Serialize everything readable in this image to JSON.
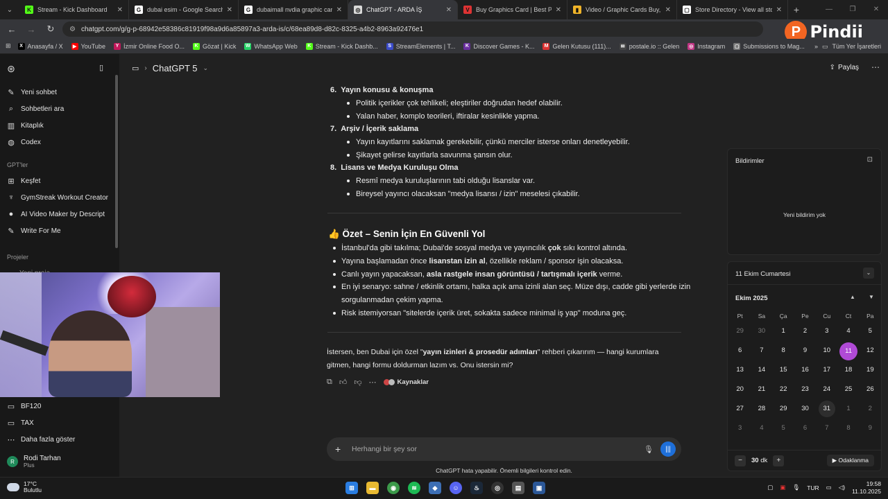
{
  "tabs": [
    {
      "label": "Stream - Kick Dashboard",
      "fav": "K",
      "color": "#53fc18",
      "active": false
    },
    {
      "label": "dubai esim - Google Search",
      "fav": "G",
      "color": "#ffffff",
      "active": false
    },
    {
      "label": "dubaimall nvdia graphic card -",
      "fav": "G",
      "color": "#ffffff",
      "active": false
    },
    {
      "label": "ChatGPT - ARDA İŞ",
      "fav": "◎",
      "color": "#d9d9d9",
      "active": true
    },
    {
      "label": "Buy Graphics Card | Best Price",
      "fav": "V",
      "color": "#d33",
      "active": false
    },
    {
      "label": "Video / Graphic Cards Buy, Bes",
      "fav": "▮",
      "color": "#f0b429",
      "active": false
    },
    {
      "label": "Store Directory - View all store",
      "fav": "▢",
      "color": "#ffffff",
      "active": false
    }
  ],
  "url": "chatgpt.com/g/g-p-68942e58386c81919f98a9d6a85897a3-arda-is/c/68ea89d8-d82c-8325-a4b2-8963a92476e1",
  "overlay_logo": {
    "letter": "P",
    "name": "Pindii"
  },
  "bookmarks": [
    {
      "label": "Anasayfa / X",
      "icon": "X",
      "color": "#000000"
    },
    {
      "label": "YouTube",
      "icon": "▶",
      "color": "#ff0000"
    },
    {
      "label": "İzmir Online Food O...",
      "icon": "Y",
      "color": "#c2185b"
    },
    {
      "label": "Gözat | Kick",
      "icon": "K",
      "color": "#53fc18"
    },
    {
      "label": "WhatsApp Web",
      "icon": "W",
      "color": "#25d366"
    },
    {
      "label": "Stream - Kick Dashb...",
      "icon": "K",
      "color": "#53fc18"
    },
    {
      "label": "StreamElements | T...",
      "icon": "S",
      "color": "#3b4cca"
    },
    {
      "label": "Discover Games - K...",
      "icon": "K",
      "color": "#6b2fa0"
    },
    {
      "label": "Gelen Kutusu (111)...",
      "icon": "M",
      "color": "#d33"
    },
    {
      "label": "postale.io :: Gelen",
      "icon": "✉",
      "color": "#444"
    },
    {
      "label": "Instagram",
      "icon": "◎",
      "color": "#c13584"
    },
    {
      "label": "Submissions to Mag...",
      "icon": "▢",
      "color": "#777"
    }
  ],
  "bookmarks_more": "»",
  "bookmarks_all": "Tüm Yer İşaretleri",
  "sidebar": {
    "items": [
      {
        "label": "Yeni sohbet",
        "icon": "✎"
      },
      {
        "label": "Sohbetleri ara",
        "icon": "⌕"
      },
      {
        "label": "Kitaplık",
        "icon": "▥"
      },
      {
        "label": "Codex",
        "icon": "◍"
      }
    ],
    "gpts_heading": "GPT'ler",
    "gpts": [
      {
        "label": "Keşfet",
        "icon": "⊞"
      },
      {
        "label": "GymStreak Workout Creator",
        "icon": "♆"
      },
      {
        "label": "AI Video Maker by Descript",
        "icon": "●"
      },
      {
        "label": "Write For Me",
        "icon": "✎"
      }
    ],
    "projects_heading": "Projeler",
    "projects_partial": "Yeni proje",
    "folders": [
      {
        "label": "BF120",
        "icon": "▭"
      },
      {
        "label": "TAX",
        "icon": "▭"
      }
    ],
    "show_more": "Daha fazla göster",
    "user": {
      "initial": "R",
      "name": "Rodi Tarhan",
      "plan": "Plus"
    }
  },
  "header": {
    "model": "ChatGPT 5",
    "share": "Paylaş"
  },
  "content": {
    "sections": [
      {
        "num": "6.",
        "title": "Yayın konusu & konuşma",
        "bullets": [
          "Politik içerikler çok tehlikeli; eleştiriler doğrudan hedef olabilir.",
          "Yalan haber, komplo teorileri, iftiralar kesinlikle yapma."
        ]
      },
      {
        "num": "7.",
        "title": "Arşiv / İçerik saklama",
        "bullets": [
          "Yayın kayıtlarını saklamak gerekebilir, çünkü merciler isterse onları denetleyebilir.",
          "Şikayet gelirse kayıtlarla savunma şansın olur."
        ]
      },
      {
        "num": "8.",
        "title": "Lisans ve Medya Kuruluşu Olma",
        "bullets": [
          "Resmî medya kuruluşlarının tabi olduğu lisanslar var.",
          "Bireysel yayıncı olacaksan \"medya lisansı / izin\" meselesi çıkabilir."
        ]
      }
    ],
    "summary_title": "👍 Özet – Senin İçin En Güvenli Yol",
    "summary": [
      {
        "pre": "İstanbul'da gibi takılma; Dubai'de sosyal medya ve yayıncılık ",
        "bold": "çok",
        "post": " sıkı kontrol altında."
      },
      {
        "pre": "Yayına başlamadan önce ",
        "bold": "lisanstan izin al",
        "post": ", özellikle reklam / sponsor işin olacaksa."
      },
      {
        "pre": "Canlı yayın yapacaksan, ",
        "bold": "asla rastgele insan görüntüsü / tartışmalı içerik",
        "post": " verme."
      },
      {
        "pre": "En iyi senaryo: sahne / etkinlik ortamı, halka açık ama izinli alan seç. Müze dışı, cadde gibi yerlerde izin",
        "bold": "",
        "post": ""
      },
      {
        "pre": "sorgulanmadan çekim yapma.",
        "bold": "",
        "post": ""
      },
      {
        "pre": "Risk istemiyorsan \"sitelerde içerik üret, sokakta sadece minimal iş yap\" moduna geç.",
        "bold": "",
        "post": ""
      }
    ],
    "closing_pre": "İstersen, ben Dubai için özel \"",
    "closing_bold": "yayın izinleri & prosedür adımları",
    "closing_post": "\" rehberi çıkarırım — hangi kurumlara",
    "closing_line2": "gitmen, hangi formu doldurman lazım vs. Onu istersin mi?",
    "sources_label": "Kaynaklar"
  },
  "composer": {
    "placeholder": "Herhangi bir şey sor",
    "disclaimer": "ChatGPT hata yapabilir. Önemli bilgileri kontrol edin."
  },
  "notifications": {
    "title": "Bildirimler",
    "empty": "Yeni bildirim yok"
  },
  "calendar": {
    "date_header": "11 Ekim Cumartesi",
    "month": "Ekim 2025",
    "weekdays": [
      "Pt",
      "Sa",
      "Ça",
      "Pe",
      "Cu",
      "Ct",
      "Pa"
    ],
    "weeks": [
      [
        "29",
        "30",
        "1",
        "2",
        "3",
        "4",
        "5"
      ],
      [
        "6",
        "7",
        "8",
        "9",
        "10",
        "11",
        "12"
      ],
      [
        "13",
        "14",
        "15",
        "16",
        "17",
        "18",
        "19"
      ],
      [
        "20",
        "21",
        "22",
        "23",
        "24",
        "25",
        "26"
      ],
      [
        "27",
        "28",
        "29",
        "30",
        "31",
        "1",
        "2"
      ],
      [
        "3",
        "4",
        "5",
        "6",
        "7",
        "8",
        "9"
      ]
    ],
    "today": "11",
    "focus_minutes": "30",
    "focus_unit": "dk",
    "focus_label": "Odaklanma"
  },
  "taskbar": {
    "temp": "17°C",
    "weather": "Bulutlu",
    "lang": "TUR",
    "time": "19:58",
    "date": "11.10.2025"
  }
}
